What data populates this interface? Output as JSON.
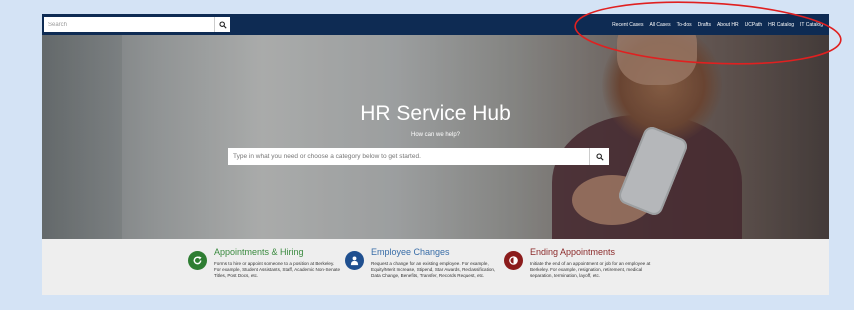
{
  "topbar": {
    "search_placeholder": "Search",
    "nav_links": [
      "Recent Cases",
      "All Cases",
      "To-dos",
      "Drafts",
      "About HR",
      "UCPath",
      "HR Catalog",
      "IT Catalog"
    ]
  },
  "hero": {
    "title": "HR Service Hub",
    "subtitle": "How can we help?",
    "search_placeholder": "Type in what you need or choose a category below to get started."
  },
  "categories": [
    {
      "title": "Appointments & Hiring",
      "description": "Forms to hire or appoint someone to a position at Berkeley. For example, Student Assistants, Staff, Academic Non-Senate Titles, Post Docs, etc.",
      "icon": "refresh-icon",
      "color": "#2e7d32",
      "title_color": "#3a8a3f"
    },
    {
      "title": "Employee Changes",
      "description": "Request a change for an existing employee. For example, Equity/Merit Increase, Stipend, Star Awards, Reclassification, Data Change, Benefits, Transfer, Records Request, etc.",
      "icon": "person-icon",
      "color": "#1f4f8f",
      "title_color": "#3a6ea8"
    },
    {
      "title": "Ending Appointments",
      "description": "Initiate the end of an appointment or job for an employee at Berkeley. For example, resignation, retirement, medical separation, termination, layoff, etc.",
      "icon": "half-circle-icon",
      "color": "#8b1c1c",
      "title_color": "#8b2a2a"
    }
  ],
  "colors": {
    "page_background": "#d4e3f5",
    "nav_background": "#0e2b53",
    "annotation": "#e02020"
  }
}
